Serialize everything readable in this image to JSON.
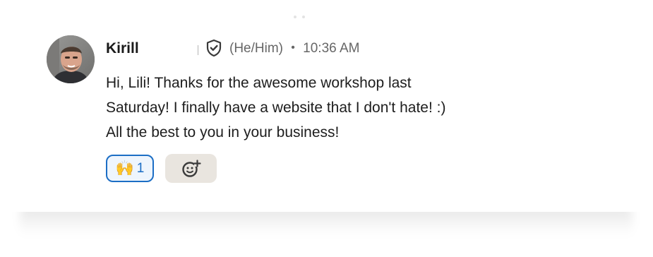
{
  "message": {
    "author": "Kirill",
    "pronouns": "(He/Him)",
    "separator": "•",
    "time": "10:36 AM",
    "lines": [
      "Hi, Lili! Thanks for the awesome workshop last",
      "Saturday! I finally have a website that I don't hate! :)",
      "All the best to you in your business!"
    ]
  },
  "reactions": [
    {
      "emoji": "🙌",
      "emoji_name": "raising-hands",
      "count": "1",
      "selected": true
    }
  ],
  "icons": {
    "verified": "shield-check-icon",
    "add_reaction": "add-emoji-icon"
  },
  "colors": {
    "accent": "#1c6ec5",
    "reaction_bg": "#eef5fd",
    "add_reaction_bg": "#e9e5df",
    "name": "#1a1a1a",
    "meta": "#666666",
    "body_text": "#1d1d1d"
  }
}
